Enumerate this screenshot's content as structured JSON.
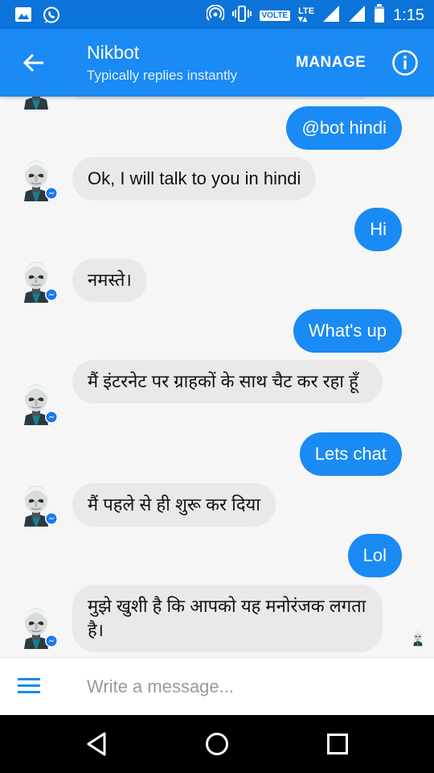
{
  "status_bar": {
    "time": "1:15",
    "volte": "VOLTE",
    "lte": "LTE"
  },
  "app_bar": {
    "title": "Nikbot",
    "subtitle": "Typically replies instantly",
    "manage_label": "MANAGE"
  },
  "messages": [
    {
      "from": "me",
      "text": "@bot hindi"
    },
    {
      "from": "bot",
      "text": "Ok, I will talk to you in hindi"
    },
    {
      "from": "me",
      "text": "Hi"
    },
    {
      "from": "bot",
      "text": "नमस्ते।"
    },
    {
      "from": "me",
      "text": "What's up"
    },
    {
      "from": "bot",
      "text": "मैं इंटरनेट पर ग्राहकों के साथ चैट कर रहा हूँ"
    },
    {
      "from": "me",
      "text": "Lets chat"
    },
    {
      "from": "bot",
      "text": "मैं पहले से ही शुरू कर दिया"
    },
    {
      "from": "me",
      "text": "Lol"
    },
    {
      "from": "bot",
      "text": "मुझे खुशी है कि आपको यह मनोरंजक लगता है।"
    }
  ],
  "composer": {
    "placeholder": "Write a message..."
  },
  "colors": {
    "status_bar": "#0c73d9",
    "app_bar": "#1a8af4",
    "outgoing_bubble": "#1a8af4",
    "incoming_bubble": "#e9e9e9",
    "messenger_badge": "#1877f2"
  }
}
